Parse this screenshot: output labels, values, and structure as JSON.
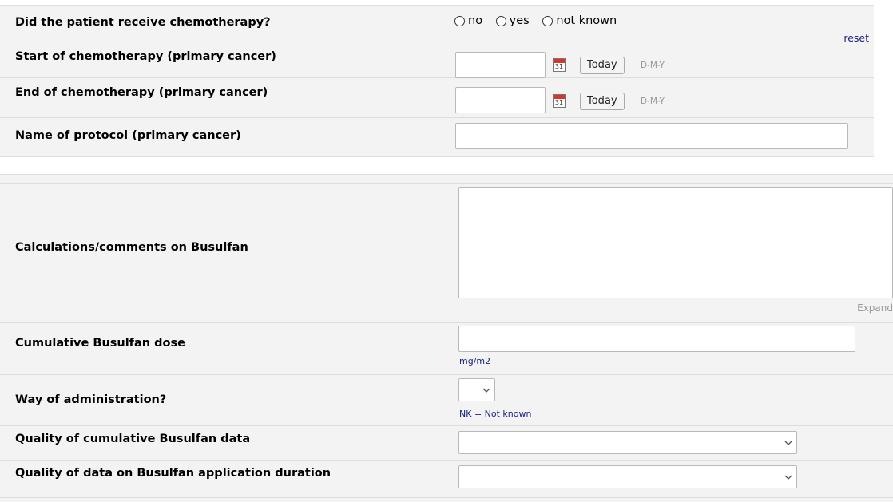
{
  "chemo": {
    "question": "Did the patient receive chemotherapy?",
    "options": [
      "no",
      "yes",
      "not known"
    ],
    "reset_label": "reset"
  },
  "start_chemo": {
    "label": "Start of chemotherapy (primary cancer)",
    "value": "",
    "today_label": "Today",
    "format": "D-M-Y",
    "calendar_day": "31"
  },
  "end_chemo": {
    "label": "End of chemotherapy (primary cancer)",
    "value": "",
    "today_label": "Today",
    "format": "D-M-Y",
    "calendar_day": "31"
  },
  "protocol": {
    "label": "Name of protocol (primary cancer)",
    "value": ""
  },
  "busulfan_comments": {
    "label": "Calculations/comments on Busulfan",
    "value": "",
    "expand_label": "Expand"
  },
  "cumulative_dose": {
    "label": "Cumulative Busulfan dose",
    "value": "",
    "unit": "mg/m2"
  },
  "administration": {
    "label": "Way of administration?",
    "selected": "",
    "hint": "NK = Not known"
  },
  "quality_cumulative": {
    "label": "Quality of cumulative Busulfan data",
    "selected": ""
  },
  "quality_duration": {
    "label": "Quality of data on Busulfan application duration",
    "selected": ""
  },
  "colors": {
    "row_bg": "#f3f3f3",
    "border": "#dddddd",
    "link": "#1a237e",
    "calendar_red": "#d9342b"
  },
  "icons": [
    "calendar-icon",
    "chevron-down-icon",
    "radio-icon"
  ]
}
